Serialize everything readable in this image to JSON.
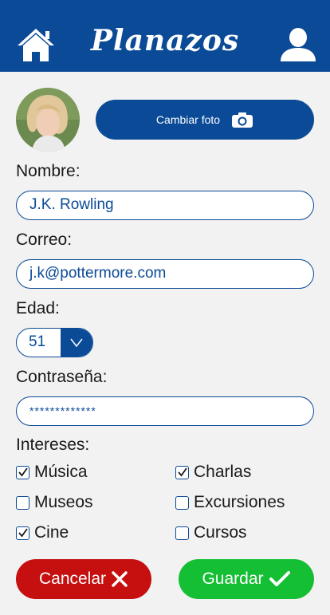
{
  "header": {
    "title": "Planazos",
    "home_icon": "home-icon",
    "user_icon": "user-icon"
  },
  "profile": {
    "change_photo_label": "Cambiar foto",
    "camera_icon": "camera-icon"
  },
  "form": {
    "name_label": "Nombre:",
    "name_value": "J.K. Rowling",
    "email_label": "Correo:",
    "email_value": "j.k@pottermore.com",
    "age_label": "Edad:",
    "age_value": "51",
    "password_label": "Contraseña:",
    "password_value": "*************",
    "interests_label": "Intereses:",
    "interests": [
      {
        "label": "Música",
        "checked": true
      },
      {
        "label": "Charlas",
        "checked": true
      },
      {
        "label": "Museos",
        "checked": false
      },
      {
        "label": "Excursiones",
        "checked": false
      },
      {
        "label": "Cine",
        "checked": true
      },
      {
        "label": "Cursos",
        "checked": false
      }
    ]
  },
  "actions": {
    "cancel_label": "Cancelar",
    "save_label": "Guardar"
  },
  "colors": {
    "primary": "#0a4a96",
    "cancel": "#c60f0f",
    "save": "#14bf33",
    "background": "#f2f2f2"
  }
}
